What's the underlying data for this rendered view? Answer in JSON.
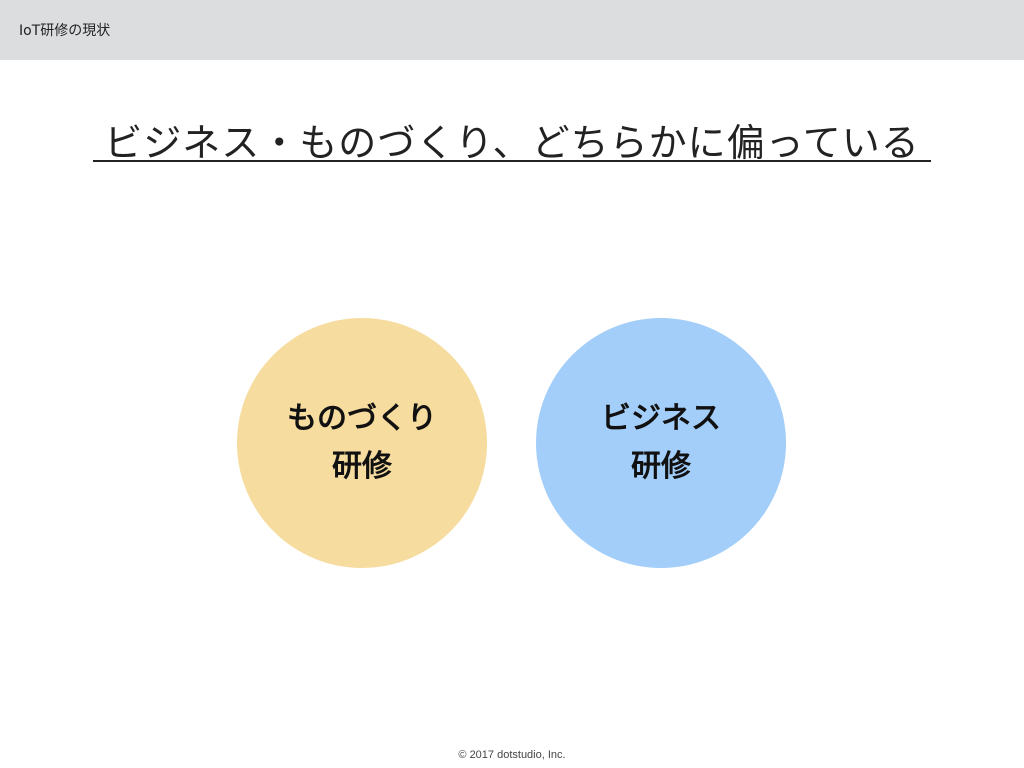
{
  "header": {
    "title": "IoT研修の現状",
    "background": "#dcdddf"
  },
  "heading": {
    "text": "ビジネス・ものづくり、どちらかに偏っている"
  },
  "circles": [
    {
      "line1": "ものづくり",
      "line2": "研修",
      "color": "#f6dc9e"
    },
    {
      "line1": "ビジネス",
      "line2": "研修",
      "color": "#a3cef9"
    }
  ],
  "footer": {
    "copyright": "© 2017 dotstudio, Inc."
  }
}
